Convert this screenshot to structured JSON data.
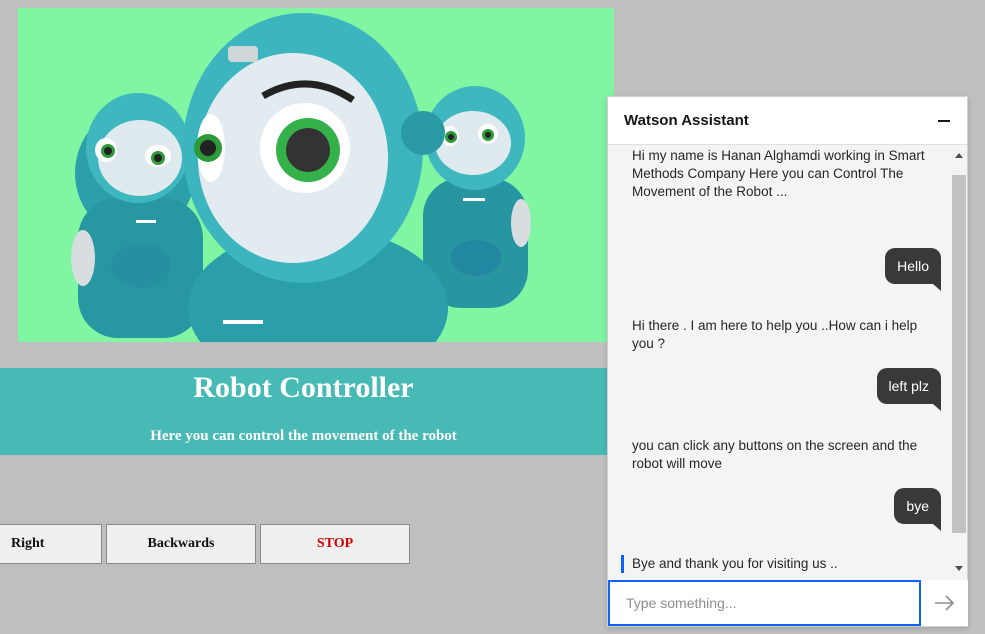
{
  "banner": {
    "title": "Robot Controller",
    "subtitle": "Here you can control the movement of the robot"
  },
  "controls": {
    "right_label": "Right",
    "backwards_label": "Backwards",
    "stop_label": "STOP",
    "stop_color": "#d10000"
  },
  "chat": {
    "title": "Watson Assistant",
    "placeholder": "Type something...",
    "messages": [
      {
        "from": "bot",
        "text": "Hi my name is Hanan Alghamdi working in Smart Methods Company Here you can Control The Movement of the Robot ..."
      },
      {
        "from": "user",
        "text": "Hello"
      },
      {
        "from": "bot",
        "text": "Hi there . I am here to help you ..How can i help you ?"
      },
      {
        "from": "user",
        "text": "left plz"
      },
      {
        "from": "bot",
        "text": "you can click any buttons on the screen and the robot will move"
      },
      {
        "from": "user",
        "text": "bye"
      },
      {
        "from": "bot",
        "text": "Bye and thank you for visiting us .."
      }
    ],
    "accent_color": "#0f62fe"
  },
  "colors": {
    "page_bg": "#c0bfbf",
    "banner_bg": "#48bab5",
    "hero_bg": "#80f5a2",
    "robot_body": "#2aa3ad"
  }
}
